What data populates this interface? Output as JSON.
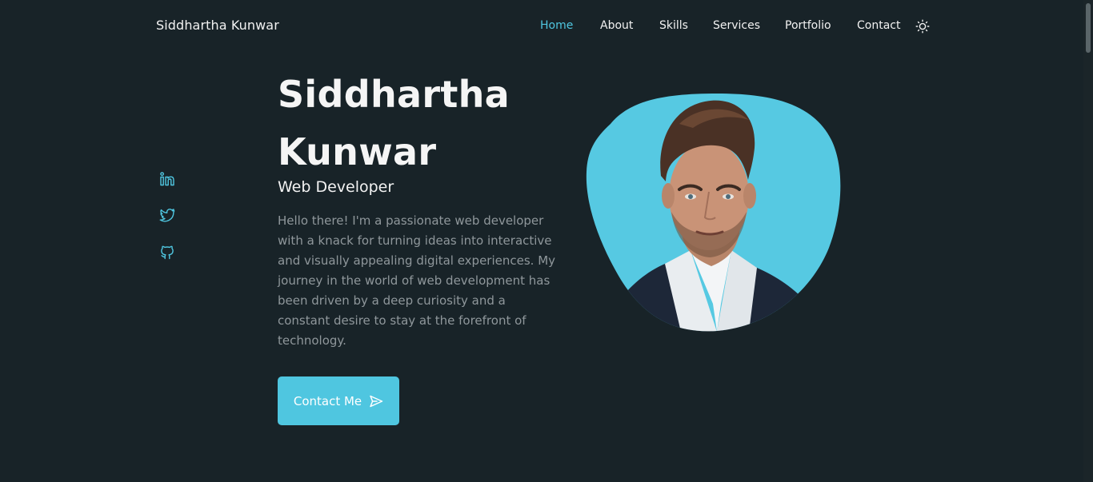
{
  "header": {
    "logo": "Siddhartha Kunwar",
    "nav": [
      {
        "label": "Home",
        "active": true
      },
      {
        "label": "About",
        "active": false
      },
      {
        "label": "Skills",
        "active": false
      },
      {
        "label": "Services",
        "active": false
      },
      {
        "label": "Portfolio",
        "active": false
      },
      {
        "label": "Contact",
        "active": false
      }
    ],
    "theme_toggle_icon": "sun-icon"
  },
  "socials": [
    {
      "icon": "linkedin-icon"
    },
    {
      "icon": "twitter-icon"
    },
    {
      "icon": "github-icon"
    }
  ],
  "hero": {
    "title_line1": "Siddhartha",
    "title_line2": "Kunwar",
    "subtitle": "Web Developer",
    "description": "Hello there! I'm a passionate web developer with a knack for turning ideas into interactive and visually appealing digital experiences. My journey in the world of web development has been driven by a deep curiosity and a constant desire to stay at the forefront of technology.",
    "cta_label": "Contact Me",
    "cta_icon": "send-icon",
    "image": "profile-photo"
  },
  "colors": {
    "background": "#182328",
    "accent": "#4fc6e0",
    "text": "#f2f2f2",
    "muted_text": "#8f979b"
  }
}
